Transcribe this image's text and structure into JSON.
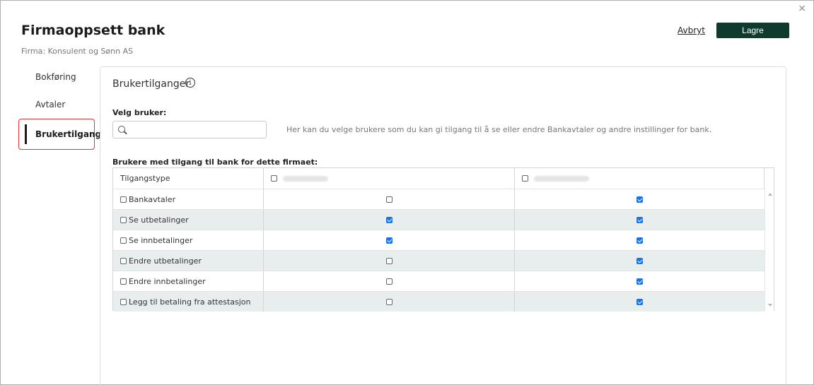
{
  "header": {
    "title": "Firmaoppsett bank",
    "subtitle": "Firma: Konsulent og Sønn AS",
    "cancel_label": "Avbryt",
    "save_label": "Lagre",
    "close_glyph": "×"
  },
  "sidebar": {
    "items": [
      {
        "label": "Bokføring",
        "active": false
      },
      {
        "label": "Avtaler",
        "active": false
      },
      {
        "label": "Brukertilgang",
        "active": true
      }
    ]
  },
  "main": {
    "section_title": "Brukertilganger",
    "info_glyph": "i",
    "select_user_label": "Velg bruker:",
    "search_value": "",
    "search_placeholder": "",
    "help_text": "Her kan du velge brukere som du kan gi tilgang til å se eller endre Bankavtaler og andre instillinger for bank.",
    "table_title": "Brukere med tilgang til bank for dette firmaet:",
    "table": {
      "first_column_header": "Tilgangstype",
      "user_columns": [
        {
          "name": "",
          "checked": false,
          "obscured": true
        },
        {
          "name": "",
          "checked": false,
          "obscured": true
        }
      ],
      "rows": [
        {
          "label": "Bankavtaler",
          "row_checked": false,
          "user1": false,
          "user2": true
        },
        {
          "label": "Se utbetalinger",
          "row_checked": false,
          "user1": true,
          "user2": true
        },
        {
          "label": "Se innbetalinger",
          "row_checked": false,
          "user1": true,
          "user2": true
        },
        {
          "label": "Endre utbetalinger",
          "row_checked": false,
          "user1": false,
          "user2": true
        },
        {
          "label": "Endre innbetalinger",
          "row_checked": false,
          "user1": false,
          "user2": true
        },
        {
          "label": "Legg til betaling fra attestasjon",
          "row_checked": false,
          "user1": false,
          "user2": true
        }
      ]
    }
  },
  "colors": {
    "primary_button": "#0e3b2d",
    "checkbox_checked": "#1a73e8",
    "active_highlight": "#e0353b",
    "row_alt": "#e8eeee"
  },
  "icons": {
    "close": "close-icon",
    "info": "info-icon",
    "search": "search-icon"
  }
}
